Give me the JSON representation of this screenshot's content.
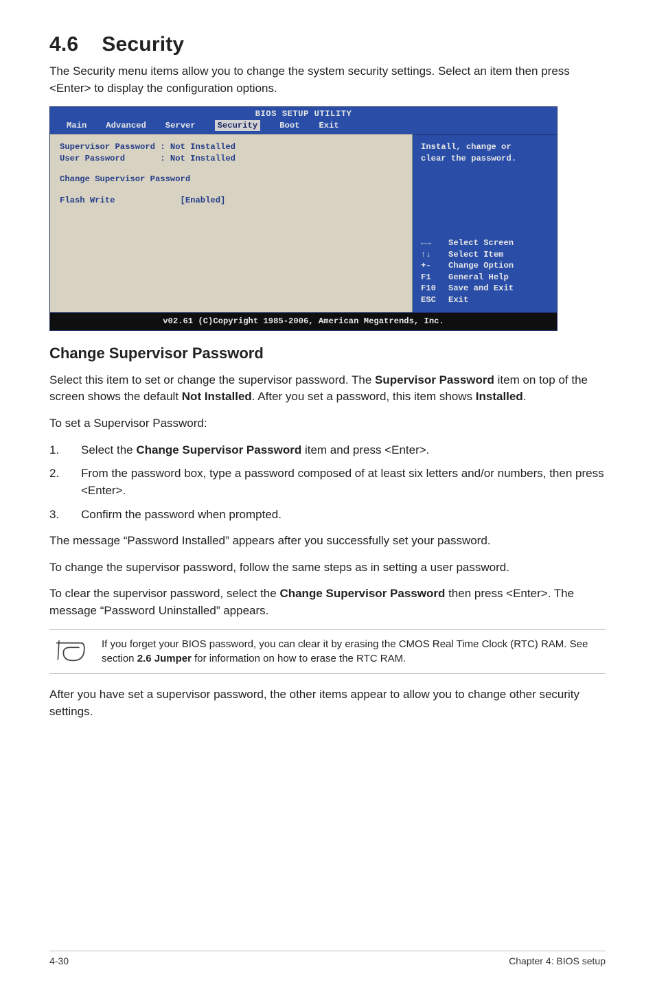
{
  "heading": {
    "number": "4.6",
    "title": "Security"
  },
  "intro": "The Security menu items allow you to change the system security settings. Select an item then press <Enter> to display the configuration options.",
  "bios": {
    "title": "BIOS SETUP UTILITY",
    "tabs": {
      "main": "Main",
      "advanced": "Advanced",
      "server": "Server",
      "security": "Security",
      "boot": "Boot",
      "exit": "Exit"
    },
    "left": {
      "line1": "Supervisor Password : Not Installed",
      "line2": "User Password       : Not Installed",
      "line3": "Change Supervisor Password",
      "line4_label": "Flash Write",
      "line4_value": "[Enabled]"
    },
    "right": {
      "help1": "Install, change or",
      "help2": "clear the password.",
      "legend": {
        "select_screen": "Select Screen",
        "select_item": "Select Item",
        "change_option": "Change Option",
        "general_help": "General Help",
        "save_exit": "Save and Exit",
        "exit": "Exit",
        "k_arrows_lr": "←→",
        "k_arrows_ud": "↑↓",
        "k_pm": "+-",
        "k_f1": "F1",
        "k_f10": "F10",
        "k_esc": "ESC"
      }
    },
    "footer": "v02.61 (C)Copyright 1985-2006, American Megatrends, Inc."
  },
  "sub": {
    "title": "Change Supervisor Password",
    "p1_a": "Select this item to set or change the supervisor password. The ",
    "p1_b": "Supervisor Password",
    "p1_c": " item on top of the screen shows the default ",
    "p1_d": "Not Installed",
    "p1_e": ". After you set a password, this item shows ",
    "p1_f": "Installed",
    "p1_g": ".",
    "p2": "To set a Supervisor Password:",
    "steps": {
      "s1_a": "Select the ",
      "s1_b": "Change Supervisor Password",
      "s1_c": " item and press <Enter>.",
      "s2": "From the password box, type a password composed of at least six letters and/or numbers, then press <Enter>.",
      "s3": "Confirm the password when prompted."
    },
    "p3": "The message “Password Installed” appears after you successfully set your password.",
    "p4": "To change the supervisor password, follow the same steps as in setting a user password.",
    "p5_a": "To clear the supervisor password, select the ",
    "p5_b": "Change Supervisor Password",
    "p5_c": " then press <Enter>. The message “Password Uninstalled” appears.",
    "note_a": "If you forget your BIOS password, you can clear it by erasing the CMOS Real Time Clock (RTC) RAM. See section ",
    "note_b": "2.6 Jumper",
    "note_c": " for information on how to erase the RTC RAM.",
    "p6": "After you have set a supervisor password, the other items appear to allow you to change other security settings."
  },
  "footer": {
    "left": "4-30",
    "right": "Chapter 4: BIOS setup"
  }
}
